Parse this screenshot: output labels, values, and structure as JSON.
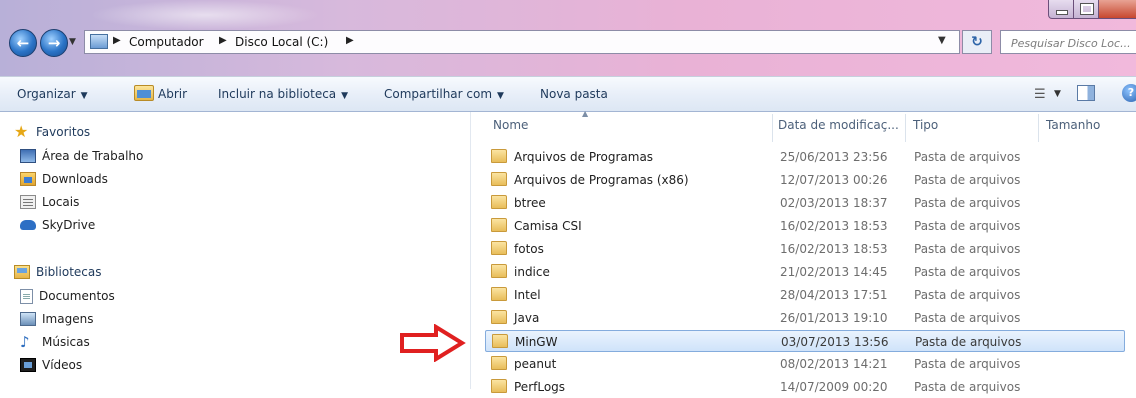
{
  "address": {
    "breadcrumbs": [
      "Computador",
      "Disco Local (C:)"
    ],
    "search_placeholder": "Pesquisar Disco Loc..."
  },
  "toolbar": {
    "organize": "Organizar",
    "open": "Abrir",
    "include_library": "Incluir na biblioteca",
    "share": "Compartilhar com",
    "new_folder": "Nova pasta"
  },
  "nav": {
    "favorites_header": "Favoritos",
    "favorites": [
      "Área de Trabalho",
      "Downloads",
      "Locais",
      "SkyDrive"
    ],
    "libraries_header": "Bibliotecas",
    "libraries": [
      "Documentos",
      "Imagens",
      "Músicas",
      "Vídeos"
    ]
  },
  "columns": {
    "name": "Nome",
    "date": "Data de modificaç...",
    "type": "Tipo",
    "size": "Tamanho"
  },
  "files": [
    {
      "name": "Arquivos de Programas",
      "date": "25/06/2013 23:56",
      "type": "Pasta de arquivos"
    },
    {
      "name": "Arquivos de Programas (x86)",
      "date": "12/07/2013 00:26",
      "type": "Pasta de arquivos"
    },
    {
      "name": "btree",
      "date": "02/03/2013 18:37",
      "type": "Pasta de arquivos"
    },
    {
      "name": "Camisa CSI",
      "date": "16/02/2013 18:53",
      "type": "Pasta de arquivos"
    },
    {
      "name": "fotos",
      "date": "16/02/2013 18:53",
      "type": "Pasta de arquivos"
    },
    {
      "name": "indice",
      "date": "21/02/2013 14:45",
      "type": "Pasta de arquivos"
    },
    {
      "name": "Intel",
      "date": "28/04/2013 17:51",
      "type": "Pasta de arquivos"
    },
    {
      "name": "Java",
      "date": "26/01/2013 19:10",
      "type": "Pasta de arquivos"
    },
    {
      "name": "MinGW",
      "date": "03/07/2013 13:56",
      "type": "Pasta de arquivos"
    },
    {
      "name": "peanut",
      "date": "08/02/2013 14:21",
      "type": "Pasta de arquivos"
    },
    {
      "name": "PerfLogs",
      "date": "14/07/2009 00:20",
      "type": "Pasta de arquivos"
    }
  ],
  "colors": {
    "selection_border": "#84acdd",
    "annotation_arrow": "#e02020"
  }
}
